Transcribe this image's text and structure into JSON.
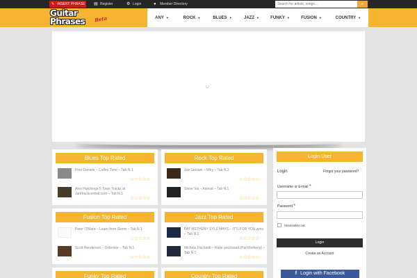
{
  "topbar": {
    "insert_label": "INSERT PHRASE",
    "register_label": "Register",
    "login_label": "Login",
    "directory_label": "Member Directory",
    "search_placeholder": "Search for artists, songs..."
  },
  "logo": {
    "line1": "Guitar",
    "line2": "Phrases",
    "beta": "Beta"
  },
  "nav": [
    {
      "label": "ANY"
    },
    {
      "label": "ROCK"
    },
    {
      "label": "BLUES"
    },
    {
      "label": "JAZZ"
    },
    {
      "label": "FUNKY"
    },
    {
      "label": "FUSION"
    },
    {
      "label": "COUNTRY"
    }
  ],
  "panels": {
    "blues": {
      "title": "Blues Top Rated",
      "items": [
        {
          "title": "Pino Daniele – Coffee Time – Tab N.1"
        },
        {
          "title": "Alex Hutchings 5 Town Tracks at Jamtrackcentral.com – Tab N.1"
        }
      ]
    },
    "rock": {
      "title": "Rock Top Rated",
      "items": [
        {
          "title": "Joe Satriani – Why – Tab N.2"
        },
        {
          "title": "Steve Vai – Animal – Tab N.1"
        }
      ]
    },
    "fusion": {
      "title": "Fusion Top Rated",
      "items": [
        {
          "title": "Peter O'Mara – Learn from Storm – Tab N.1"
        },
        {
          "title": "Scott Henderson – Dolemite – Tab N.1"
        }
      ]
    },
    "jazz": {
      "title": "Jazz Top Rated",
      "items": [
        {
          "title": "PAT METHENY SYLE MAYS – IT'S FOR YOU.wmv – Tab N.1"
        },
        {
          "title": "Michele Fischietti – Have you heard (Pat Metheny) – Tab N.1"
        }
      ]
    },
    "funky": {
      "title": "Funky Top Rated"
    },
    "country": {
      "title": "Country Top Rated"
    }
  },
  "login": {
    "title": "Login User",
    "subtitle": "Login",
    "forgot": "Forgot your password?",
    "user_label": "Username or E-mail",
    "password_label": "Password",
    "required_mark": "*",
    "remember": "REMEMBER ME",
    "login_button": "Login",
    "create_account": "Create an Account",
    "facebook_button": "Login with Facebook",
    "facebook_glyph": "f"
  },
  "stars_text": "☆☆☆☆☆",
  "colors": {
    "accent": "#f6b530",
    "insert": "#d01818",
    "facebook": "#3a5998"
  }
}
